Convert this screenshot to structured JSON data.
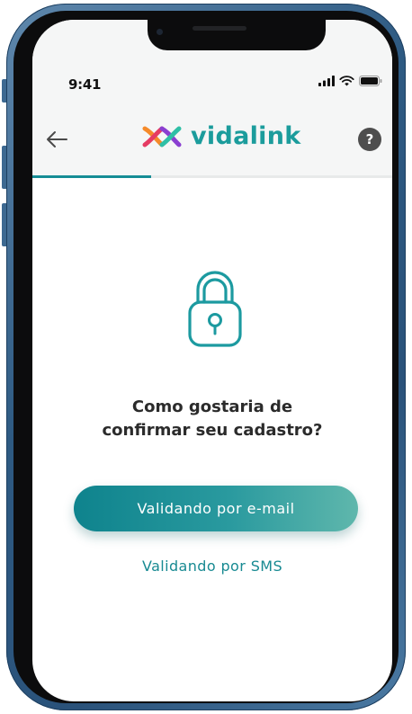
{
  "status_bar": {
    "time": "9:41",
    "icons": [
      "signal-icon",
      "wifi-icon",
      "battery-icon"
    ]
  },
  "header": {
    "back_icon": "arrow-left-icon",
    "brand_name": "vidalink",
    "help_label": "?",
    "progress": 0.33
  },
  "main": {
    "icon": "padlock-icon",
    "question_line1": "Como gostaria de",
    "question_line2": "confirmar seu cadastro?",
    "primary_button_label": "Validando por e-mail",
    "secondary_link_label": "Validando por SMS"
  },
  "colors": {
    "brand_teal": "#1b9c9c",
    "button_gradient_start": "#0e838d",
    "button_gradient_end": "#5fb7ac",
    "link": "#188a92",
    "header_bg": "#f5f6f6",
    "phone_frame": "#2e5a82"
  }
}
